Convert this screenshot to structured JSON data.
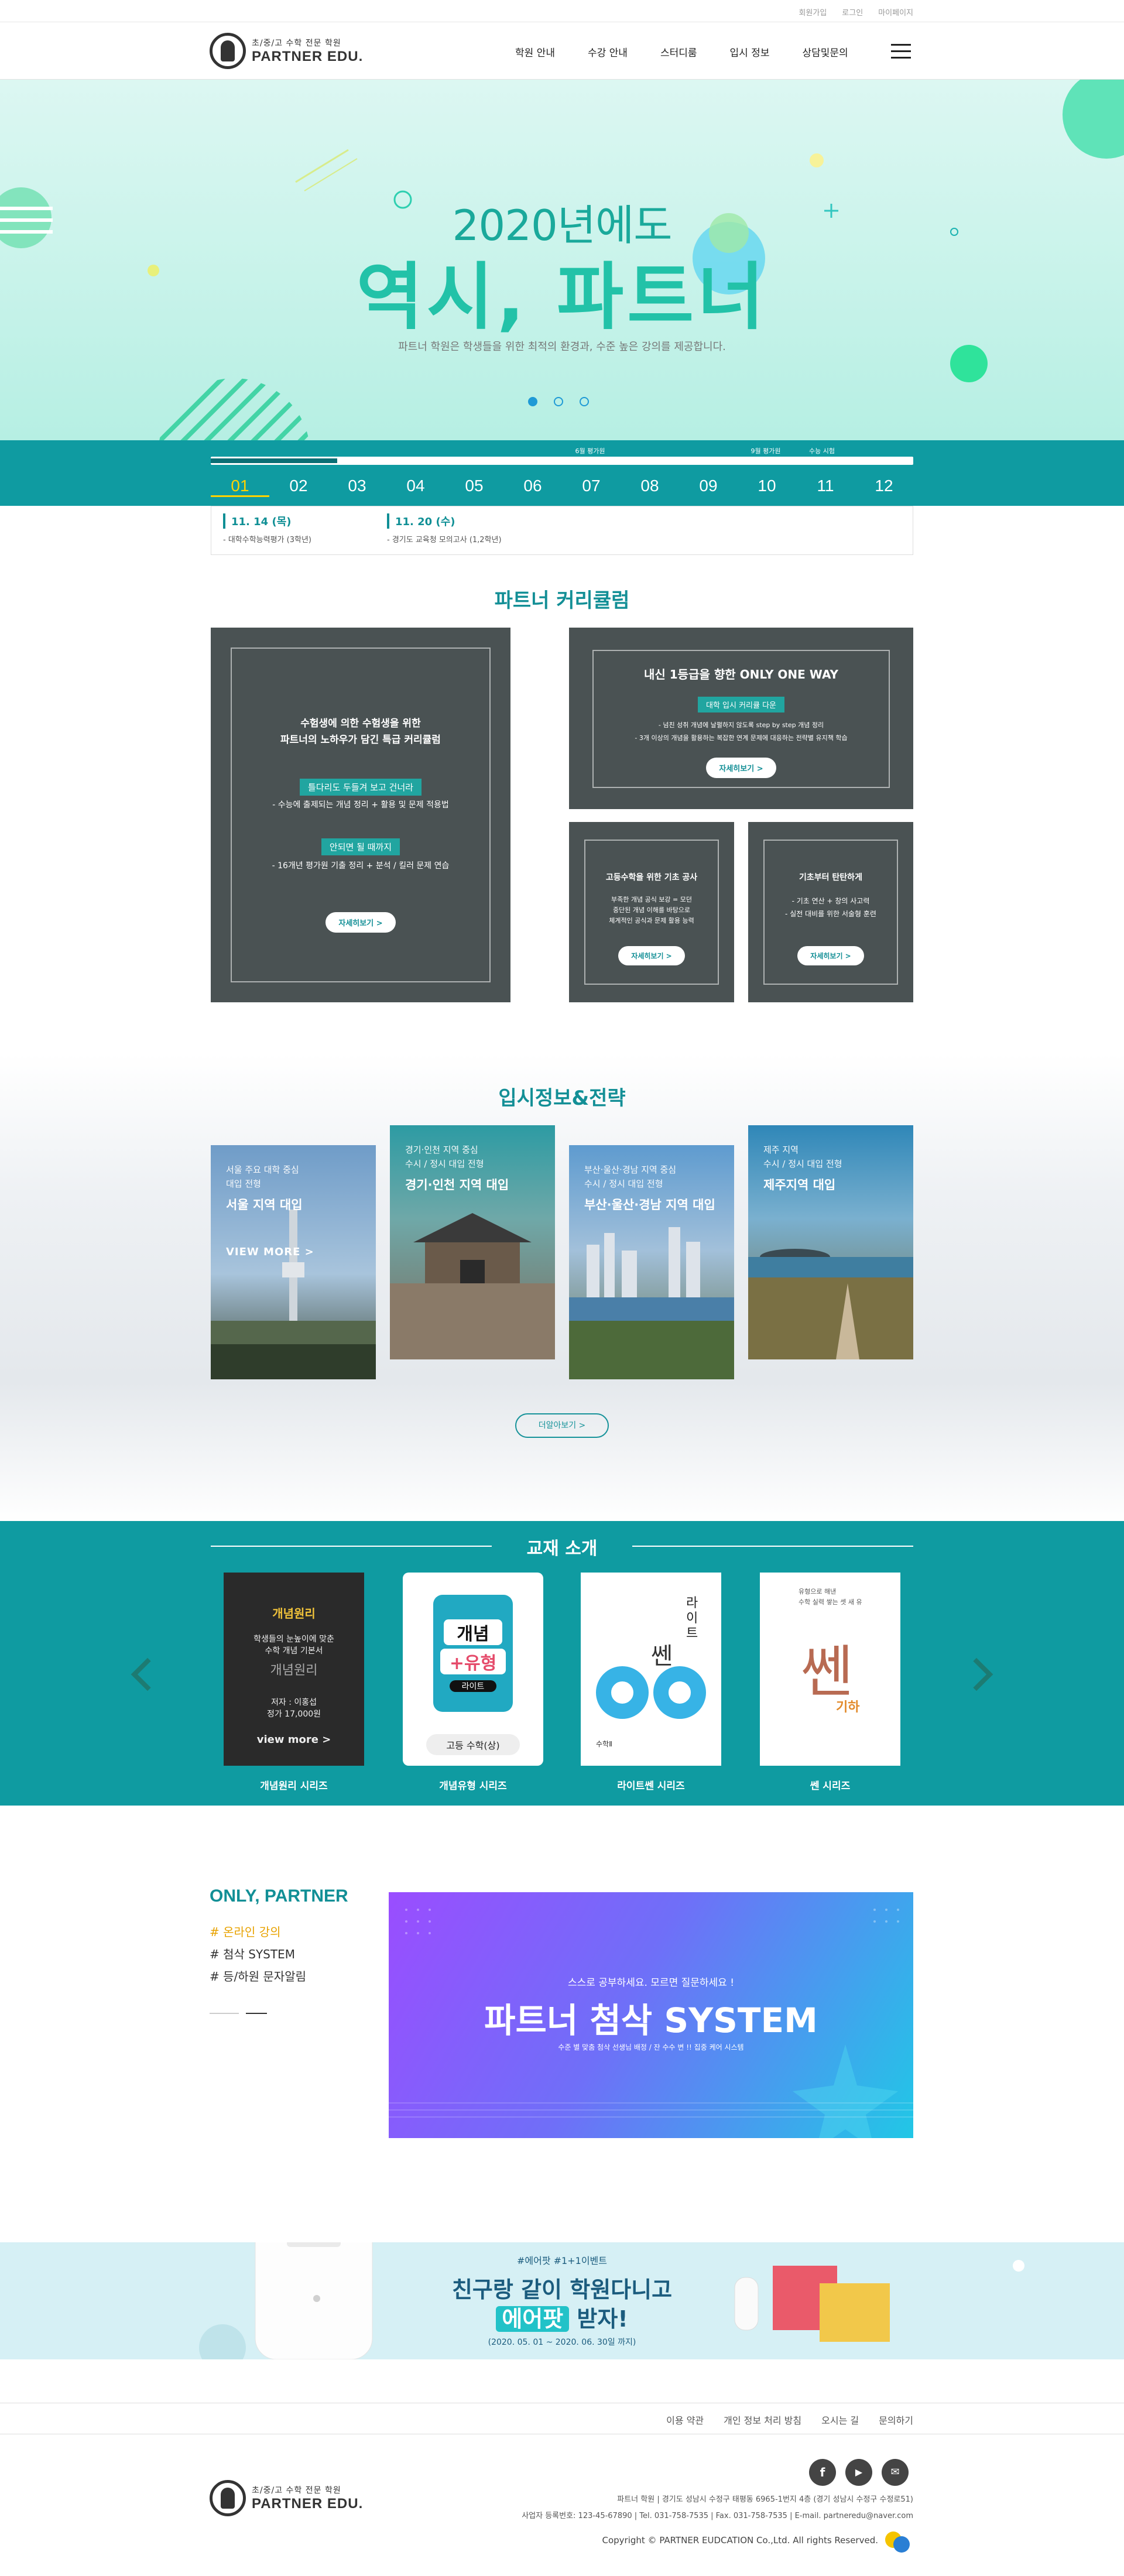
{
  "util": {
    "join": "회원가입",
    "login": "로그인",
    "mypage": "마이페이지"
  },
  "brand": {
    "sub": "초/중/고 수학 전문 학원",
    "name": "PARTNER EDU."
  },
  "nav": [
    "학원 안내",
    "수강 안내",
    "스터디룸",
    "입시 정보",
    "상담및문의"
  ],
  "hero": {
    "year": "2020년에도",
    "headline": "역시, 파트너",
    "desc": "파트너 학원은 학생들을 위한 최적의 환경과, 수준 높은 강의를 제공합니다."
  },
  "timeline": {
    "months": [
      "01",
      "02",
      "03",
      "04",
      "05",
      "06",
      "07",
      "08",
      "09",
      "10",
      "11",
      "12"
    ],
    "active": "01",
    "events": [
      {
        "label": "6월 평가원",
        "m": 6
      },
      {
        "label": "9월 평가원",
        "m": 9
      },
      {
        "label": "수능 시험",
        "m": 11
      }
    ],
    "items": [
      {
        "date": "11. 14 (목)",
        "desc": "- 대학수학능력평가 (3학년)"
      },
      {
        "date": "11. 20 (수)",
        "desc": "- 경기도 교육청 모의고사 (1,2학년)"
      }
    ]
  },
  "curriculum": {
    "title": "파트너 커리큘럼",
    "main": {
      "h1": "수험생에 의한 수험생을 위한",
      "h2": "파트너의 노하우가 담긴 특급 커리큘럼",
      "tag1": "틀다리도 두들겨 보고 건너라",
      "d1": "- 수능에 출제되는 개념 정리 + 활용 및 문제 적용법",
      "tag2": "안되면 될 때까지",
      "d2": "- 16개년 평가원 기출 정리 + 분석 / 킬러 문제 연습",
      "btn": "자세히보기 >"
    },
    "top": {
      "h": "내신 1등급을 향한  ONLY ONE WAY",
      "tag": "대학 입시 커리큘 다운",
      "l1": "- 넘친 성취 개념에 날펼하지 않도록 step by step 개념 정리",
      "l2": "- 3개 이상의 개념을 활용하는 복잡한 연계 문제에 대응하는 전략별 유지책 학습",
      "btn": "자세히보기 >"
    },
    "b1": {
      "h": "고등수학을 위한 기초 공사",
      "l1": "부족한 개념 공식 보강 = 모던",
      "l2": "중단된 개념 이해를 바탕으로",
      "l3": "체계적인 공식과 문제 활용 능력",
      "btn": "자세히보기 >"
    },
    "b2": {
      "h": "기초부터 탄탄하게",
      "l1": "- 기초 연산 + 창의 사고력",
      "l2": "- 실전 대비를 위한 서술형 훈련",
      "btn": "자세히보기 >"
    }
  },
  "strategy": {
    "title": "입시정보&전략",
    "cards": [
      {
        "sub1": "서울 주요 대학 중심",
        "sub2": "대입 전형",
        "name": "서울 지역 대입",
        "view": "VIEW MORE >"
      },
      {
        "sub1": "경기·인천 지역 중심",
        "sub2": "수시 / 정시 대입 전형",
        "name": "경기·인천 지역 대입"
      },
      {
        "sub1": "부산·울산·경남 지역 중심",
        "sub2": "수시 / 정시 대입 전형",
        "name": "부산·울산·경남 지역 대입"
      },
      {
        "sub1": "제주 지역",
        "sub2": "수시 / 정시 대입 전형",
        "name": "제주지역 대입"
      }
    ],
    "more": "더알아보기 >"
  },
  "books": {
    "title": "교재 소개",
    "items": [
      {
        "name": "개념원리 시리즈",
        "cover": {
          "t1": "개념원리",
          "t2": "학생들의 눈높이에 맞춘",
          "t3": "수학 개념 기본서",
          "t4": "개념원리",
          "t5": "저자 : 이홍섭",
          "t6": "정가 17,000원",
          "t7": "view more >"
        }
      },
      {
        "name": "개념유형 시리즈",
        "cover": {
          "t1": "개념",
          "t2": "+유형",
          "t3": "라이트",
          "t4": "고등 수학(상)"
        }
      },
      {
        "name": "라이트쎈 시리즈",
        "cover": {
          "t1": "라",
          "t2": "이",
          "t3": "트",
          "t4": "쎈",
          "t5": "수학Ⅱ"
        }
      },
      {
        "name": "쎈 시리즈",
        "cover": {
          "t1": "유형으로 해낸",
          "t2": "수학 실력 쌓는 셋 새 유",
          "t3": "쎈",
          "t4": "기하"
        }
      }
    ]
  },
  "only": {
    "title": "ONLY, PARTNER",
    "items": [
      "# 온라인 강의",
      "# 첨삭 SYSTEM",
      "# 등/하원 문자알림"
    ],
    "banner": {
      "small": "스스로 공부하세요. 모르면 질문하세요 !",
      "big": "파트너 첨삭 SYSTEM",
      "sub": "수준 별 맞춤 첨삭 선생님 배정 / 잔 수수 변 !! 집중 케어 시스템"
    }
  },
  "event": {
    "tag": "#에어팟  #1+1이벤트",
    "h1": "친구랑 같이 학원다니고",
    "hl": "에어팟",
    "h2rest": " 받자!",
    "date": "(2020. 05. 01 ~ 2020. 06. 30일 까지)"
  },
  "footer": {
    "links": [
      "이용 약관",
      "개인 정보 처리 방침",
      "오시는 길",
      "문의하기"
    ],
    "sns": [
      "f",
      "▶",
      "✉"
    ],
    "l1": "파트너 학원  |  경기도 성남시 수정구 태평동 6965-1번지 4층 (경기 성남시 수정구 수정로51)",
    "l2": "사업자 등록번호: 123-45-67890  |  Tel. 031-758-7535  |  Fax. 031-758-7535  |  E-mail. partneredu@naver.com",
    "copy": "Copyright © PARTNER EUDCATION Co.,Ltd. All rights Reserved."
  },
  "colors": {
    "teal": "#0f9ba1",
    "mint": "#22c2a8",
    "gold": "#e8a200"
  }
}
